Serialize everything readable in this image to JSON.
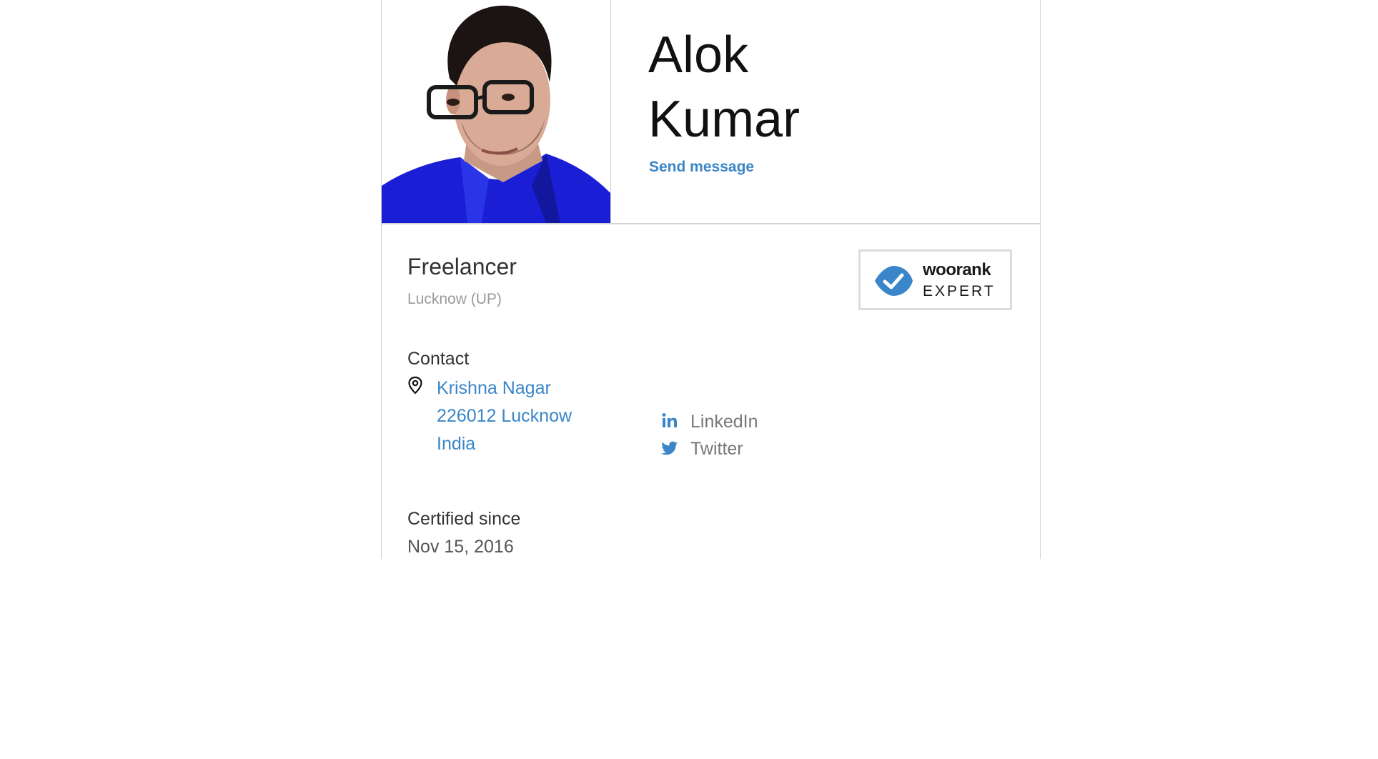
{
  "profile": {
    "first_name": "Alok",
    "last_name": "Kumar",
    "send_message": "Send message",
    "role": "Freelancer",
    "location": "Lucknow (UP)"
  },
  "badge": {
    "brand": "woorank",
    "label": "EXPERT",
    "accent_color": "#3a86c8"
  },
  "contact": {
    "title": "Contact",
    "address": {
      "street": "Krishna Nagar",
      "postal_city": "226012 Lucknow",
      "country": "India"
    },
    "social": [
      {
        "icon": "linkedin-icon",
        "label": "LinkedIn"
      },
      {
        "icon": "twitter-icon",
        "label": "Twitter"
      }
    ]
  },
  "certified": {
    "title": "Certified since",
    "date": "Nov 15, 2016"
  },
  "colors": {
    "link": "#3a86c8",
    "text": "#333333",
    "muted": "#9a9a9a",
    "shirt": "#1a1fd6"
  }
}
